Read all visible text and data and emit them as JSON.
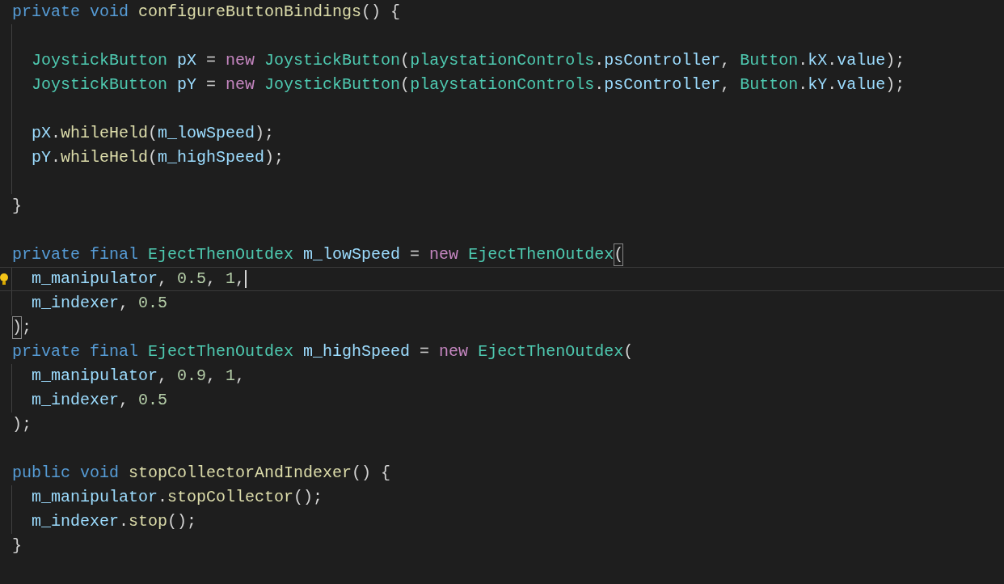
{
  "lines": [
    {
      "guide": false,
      "cursor": false,
      "lightbulb": false,
      "tokens": [
        {
          "kind": "kw",
          "text": "private"
        },
        {
          "kind": "kw",
          "text": " void"
        },
        {
          "kind": "fn",
          "text": " configureButtonBindings"
        },
        {
          "kind": "punc",
          "text": "() {"
        }
      ]
    },
    {
      "guide": true,
      "cursor": false,
      "lightbulb": false
    },
    {
      "guide": true,
      "cursor": false,
      "lightbulb": false,
      "tokens": [
        {
          "kind": "type",
          "text": "  JoystickButton"
        },
        {
          "kind": "var",
          "text": " pX"
        },
        {
          "kind": "punc",
          "text": " = "
        },
        {
          "kind": "ctrl",
          "text": "new"
        },
        {
          "kind": "type",
          "text": " JoystickButton"
        },
        {
          "kind": "punc",
          "text": "("
        },
        {
          "kind": "type",
          "text": "playstationControls"
        },
        {
          "kind": "punc",
          "text": "."
        },
        {
          "kind": "var",
          "text": "psController"
        },
        {
          "kind": "punc",
          "text": ", "
        },
        {
          "kind": "type",
          "text": "Button"
        },
        {
          "kind": "punc",
          "text": "."
        },
        {
          "kind": "var",
          "text": "kX"
        },
        {
          "kind": "punc",
          "text": "."
        },
        {
          "kind": "var",
          "text": "value"
        },
        {
          "kind": "punc",
          "text": ");"
        }
      ]
    },
    {
      "guide": true,
      "cursor": false,
      "lightbulb": false,
      "tokens": [
        {
          "kind": "type",
          "text": "  JoystickButton"
        },
        {
          "kind": "var",
          "text": " pY"
        },
        {
          "kind": "punc",
          "text": " = "
        },
        {
          "kind": "ctrl",
          "text": "new"
        },
        {
          "kind": "type",
          "text": " JoystickButton"
        },
        {
          "kind": "punc",
          "text": "("
        },
        {
          "kind": "type",
          "text": "playstationControls"
        },
        {
          "kind": "punc",
          "text": "."
        },
        {
          "kind": "var",
          "text": "psController"
        },
        {
          "kind": "punc",
          "text": ", "
        },
        {
          "kind": "type",
          "text": "Button"
        },
        {
          "kind": "punc",
          "text": "."
        },
        {
          "kind": "var",
          "text": "kY"
        },
        {
          "kind": "punc",
          "text": "."
        },
        {
          "kind": "var",
          "text": "value"
        },
        {
          "kind": "punc",
          "text": ");"
        }
      ]
    },
    {
      "guide": true,
      "cursor": false,
      "lightbulb": false
    },
    {
      "guide": true,
      "cursor": false,
      "lightbulb": false,
      "tokens": [
        {
          "kind": "var",
          "text": "  pX"
        },
        {
          "kind": "punc",
          "text": "."
        },
        {
          "kind": "fn",
          "text": "whileHeld"
        },
        {
          "kind": "punc",
          "text": "("
        },
        {
          "kind": "var",
          "text": "m_lowSpeed"
        },
        {
          "kind": "punc",
          "text": ");"
        }
      ]
    },
    {
      "guide": true,
      "cursor": false,
      "lightbulb": false,
      "tokens": [
        {
          "kind": "var",
          "text": "  pY"
        },
        {
          "kind": "punc",
          "text": "."
        },
        {
          "kind": "fn",
          "text": "whileHeld"
        },
        {
          "kind": "punc",
          "text": "("
        },
        {
          "kind": "var",
          "text": "m_highSpeed"
        },
        {
          "kind": "punc",
          "text": ");"
        }
      ]
    },
    {
      "guide": true,
      "cursor": false,
      "lightbulb": false
    },
    {
      "guide": false,
      "cursor": false,
      "lightbulb": false,
      "tokens": [
        {
          "kind": "punc",
          "text": "}"
        }
      ]
    },
    {
      "guide": false,
      "cursor": false,
      "lightbulb": false
    },
    {
      "guide": false,
      "cursor": false,
      "lightbulb": false,
      "tokens": [
        {
          "kind": "kw",
          "text": "private"
        },
        {
          "kind": "kw",
          "text": " final"
        },
        {
          "kind": "type",
          "text": " EjectThenOutdex"
        },
        {
          "kind": "var",
          "text": " m_lowSpeed"
        },
        {
          "kind": "punc",
          "text": " = "
        },
        {
          "kind": "ctrl",
          "text": "new"
        },
        {
          "kind": "type",
          "text": " EjectThenOutdex"
        },
        {
          "kind": "bracket",
          "text": "("
        }
      ]
    },
    {
      "guide": true,
      "cursor": true,
      "lightbulb": true,
      "tokens": [
        {
          "kind": "var",
          "text": "  m_manipulator"
        },
        {
          "kind": "punc",
          "text": ", "
        },
        {
          "kind": "num",
          "text": "0.5"
        },
        {
          "kind": "punc",
          "text": ", "
        },
        {
          "kind": "num",
          "text": "1"
        },
        {
          "kind": "punc",
          "text": ","
        }
      ]
    },
    {
      "guide": true,
      "cursor": false,
      "lightbulb": false,
      "tokens": [
        {
          "kind": "var",
          "text": "  m_indexer"
        },
        {
          "kind": "punc",
          "text": ", "
        },
        {
          "kind": "num",
          "text": "0.5"
        }
      ]
    },
    {
      "guide": false,
      "cursor": false,
      "lightbulb": false,
      "tokens": [
        {
          "kind": "bracket",
          "text": ")"
        },
        {
          "kind": "punc",
          "text": ";"
        }
      ]
    },
    {
      "guide": false,
      "cursor": false,
      "lightbulb": false,
      "tokens": [
        {
          "kind": "kw",
          "text": "private"
        },
        {
          "kind": "kw",
          "text": " final"
        },
        {
          "kind": "type",
          "text": " EjectThenOutdex"
        },
        {
          "kind": "var",
          "text": " m_highSpeed"
        },
        {
          "kind": "punc",
          "text": " = "
        },
        {
          "kind": "ctrl",
          "text": "new"
        },
        {
          "kind": "type",
          "text": " EjectThenOutdex"
        },
        {
          "kind": "punc",
          "text": "("
        }
      ]
    },
    {
      "guide": true,
      "cursor": false,
      "lightbulb": false,
      "tokens": [
        {
          "kind": "var",
          "text": "  m_manipulator"
        },
        {
          "kind": "punc",
          "text": ", "
        },
        {
          "kind": "num",
          "text": "0.9"
        },
        {
          "kind": "punc",
          "text": ", "
        },
        {
          "kind": "num",
          "text": "1"
        },
        {
          "kind": "punc",
          "text": ","
        }
      ]
    },
    {
      "guide": true,
      "cursor": false,
      "lightbulb": false,
      "tokens": [
        {
          "kind": "var",
          "text": "  m_indexer"
        },
        {
          "kind": "punc",
          "text": ", "
        },
        {
          "kind": "num",
          "text": "0.5"
        }
      ]
    },
    {
      "guide": false,
      "cursor": false,
      "lightbulb": false,
      "tokens": [
        {
          "kind": "punc",
          "text": ");"
        }
      ]
    },
    {
      "guide": false,
      "cursor": false,
      "lightbulb": false
    },
    {
      "guide": false,
      "cursor": false,
      "lightbulb": false,
      "tokens": [
        {
          "kind": "kw",
          "text": "public"
        },
        {
          "kind": "kw",
          "text": " void"
        },
        {
          "kind": "fn",
          "text": " stopCollectorAndIndexer"
        },
        {
          "kind": "punc",
          "text": "() {"
        }
      ]
    },
    {
      "guide": true,
      "cursor": false,
      "lightbulb": false,
      "tokens": [
        {
          "kind": "var",
          "text": "  m_manipulator"
        },
        {
          "kind": "punc",
          "text": "."
        },
        {
          "kind": "fn",
          "text": "stopCollector"
        },
        {
          "kind": "punc",
          "text": "();"
        }
      ]
    },
    {
      "guide": true,
      "cursor": false,
      "lightbulb": false,
      "tokens": [
        {
          "kind": "var",
          "text": "  m_indexer"
        },
        {
          "kind": "punc",
          "text": "."
        },
        {
          "kind": "fn",
          "text": "stop"
        },
        {
          "kind": "punc",
          "text": "();"
        }
      ]
    },
    {
      "guide": false,
      "cursor": false,
      "lightbulb": false,
      "tokens": [
        {
          "kind": "punc",
          "text": "}"
        }
      ]
    }
  ]
}
